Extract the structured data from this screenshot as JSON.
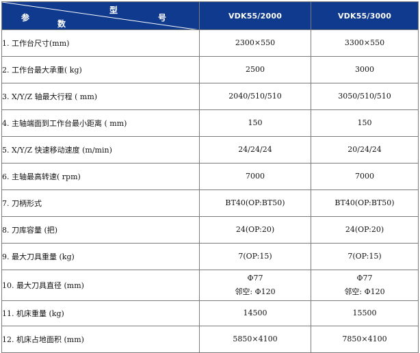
{
  "header": {
    "corner_top_left": "型",
    "corner_top_right": "号",
    "corner_bottom_left": "参",
    "corner_bottom_right": "数",
    "models": [
      "VDK55/2000",
      "VDK55/3000"
    ],
    "header_bg": "#0f3a8e"
  },
  "rows": [
    {
      "param": "1. 工作台尺寸(mm)",
      "v1": "2300×550",
      "v2": "3300×550"
    },
    {
      "param": "2. 工作台最大承重( kg)",
      "v1": "2500",
      "v2": "3000"
    },
    {
      "param": "3. X/Y/Z 轴最大行程 ( mm)",
      "v1": "2040/510/510",
      "v2": "3050/510/510"
    },
    {
      "param": "4. 主轴端面到工作台最小距离 ( mm)",
      "v1": "150",
      "v2": "150"
    },
    {
      "param": "5. X/Y/Z 快速移动速度 (m/min)",
      "v1": "24/24/24",
      "v2": "20/24/24"
    },
    {
      "param": "6. 主轴最高转速( rpm)",
      "v1": "7000",
      "v2": "7000"
    },
    {
      "param": "7. 刀柄形式",
      "v1": "BT40(OP:BT50)",
      "v2": "BT40(OP:BT50)"
    },
    {
      "param": "8. 刀库容量 (把)",
      "v1": "24(OP:20)",
      "v2": "24(OP:20)"
    },
    {
      "param": "9. 最大刀具重量 (kg)",
      "v1": "7(OP:15)",
      "v2": "7(OP:15)"
    },
    {
      "param": "10. 最大刀具直径 (mm)",
      "v1": "Φ77",
      "v1b": "邻空: Φ120",
      "v2": "Φ77",
      "v2b": "邻空: Φ120"
    },
    {
      "param": "11. 机床重量 (kg)",
      "v1": "14500",
      "v2": "15500"
    },
    {
      "param": "12. 机床占地面积 (mm)",
      "v1": "5850×4100",
      "v2": "7850×4100"
    }
  ]
}
